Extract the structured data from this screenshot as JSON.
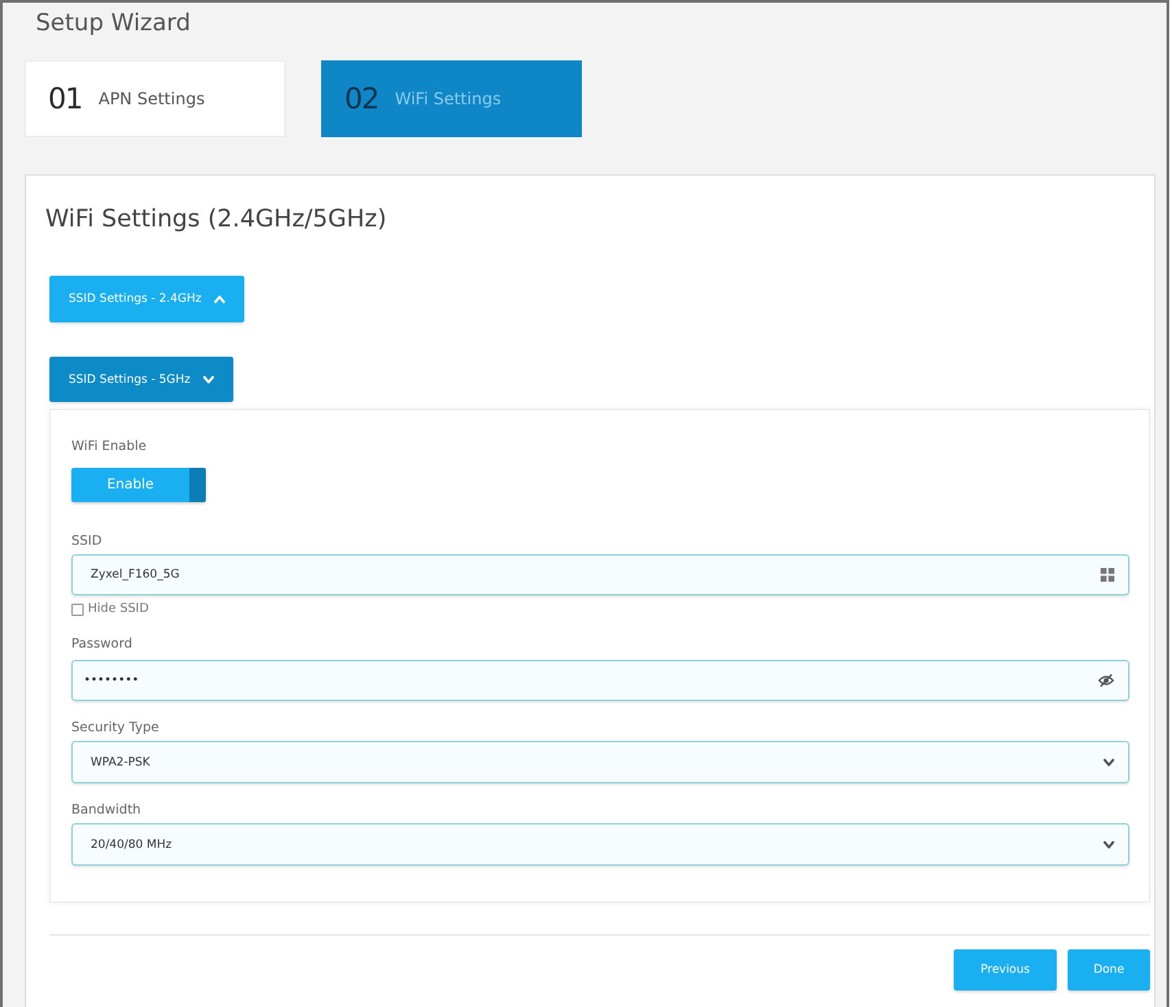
{
  "wizard": {
    "title": "Setup Wizard",
    "steps": [
      {
        "number": "01",
        "label": "APN Settings",
        "selected": false
      },
      {
        "number": "02",
        "label": "WiFi Settings",
        "selected": true
      }
    ]
  },
  "panel": {
    "heading": "WiFi Settings (2.4GHz/5GHz)",
    "sections": [
      {
        "label": "SSID Settings - 2.4GHz",
        "expanded": false
      },
      {
        "label": "SSID Settings - 5GHz",
        "expanded": true,
        "fields": [
          {
            "kind": "toggle",
            "label": "WiFi Enable",
            "text": "Enable",
            "on": true
          },
          {
            "kind": "text",
            "label": "SSID",
            "value": "Zyxel_F160_5G",
            "checkbox": {
              "label": "Hide SSID",
              "checked": false
            }
          },
          {
            "kind": "password",
            "label": "Password",
            "value": "••••••••"
          },
          {
            "kind": "select",
            "label": "Security Type",
            "value": "WPA2-PSK"
          },
          {
            "kind": "select",
            "label": "Bandwidth",
            "value": "20/40/80 MHz"
          }
        ]
      }
    ]
  },
  "buttons": [
    {
      "label": "Previous"
    },
    {
      "label": "Done"
    }
  ]
}
